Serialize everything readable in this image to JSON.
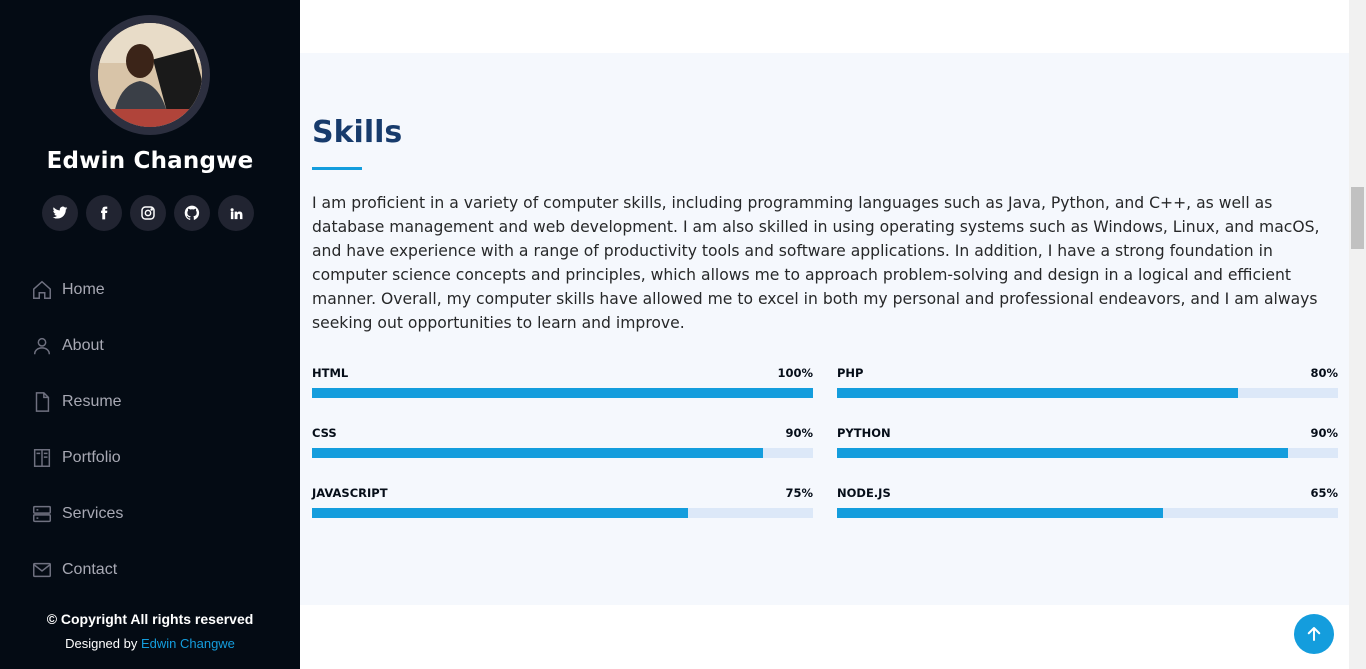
{
  "profile": {
    "name": "Edwin Changwe",
    "socials": [
      {
        "icon": "twitter-icon",
        "glyph": "🐦"
      },
      {
        "icon": "facebook-icon",
        "glyph": "f"
      },
      {
        "icon": "instagram-icon",
        "glyph": "◎"
      },
      {
        "icon": "github-icon",
        "glyph": "⊙"
      },
      {
        "icon": "linkedin-icon",
        "glyph": "in"
      }
    ]
  },
  "nav": [
    {
      "label": "Home",
      "icon": "home-icon"
    },
    {
      "label": "About",
      "icon": "person-icon"
    },
    {
      "label": "Resume",
      "icon": "file-icon"
    },
    {
      "label": "Portfolio",
      "icon": "book-icon"
    },
    {
      "label": "Services",
      "icon": "server-icon"
    },
    {
      "label": "Contact",
      "icon": "envelope-icon"
    }
  ],
  "footer": {
    "copyright": "© Copyright All rights reserved",
    "designed_by_prefix": "Designed by ",
    "designer": "Edwin Changwe"
  },
  "skills": {
    "title": "Skills",
    "description": "I am proficient in a variety of computer skills, including programming languages such as Java, Python, and C++, as well as database management and web development. I am also skilled in using operating systems such as Windows, Linux, and macOS, and have experience with a range of productivity tools and software applications. In addition, I have a strong foundation in computer science concepts and principles, which allows me to approach problem-solving and design in a logical and efficient manner. Overall, my computer skills have allowed me to excel in both my personal and professional endeavors, and I am always seeking out opportunities to learn and improve.",
    "items": [
      {
        "name": "HTML",
        "percent_label": "100%",
        "value": 100
      },
      {
        "name": "PHP",
        "percent_label": "80%",
        "value": 80
      },
      {
        "name": "CSS",
        "percent_label": "90%",
        "value": 90
      },
      {
        "name": "PYTHON",
        "percent_label": "90%",
        "value": 90
      },
      {
        "name": "JAVASCRIPT",
        "percent_label": "75%",
        "value": 75
      },
      {
        "name": "NODE.JS",
        "percent_label": "65%",
        "value": 65
      }
    ]
  },
  "colors": {
    "accent": "#149ddd",
    "sidebar_bg": "#040b14",
    "title": "#173b6c",
    "section_bg": "#f5f8fd"
  },
  "back_to_top": {
    "icon": "arrow-up-icon"
  }
}
